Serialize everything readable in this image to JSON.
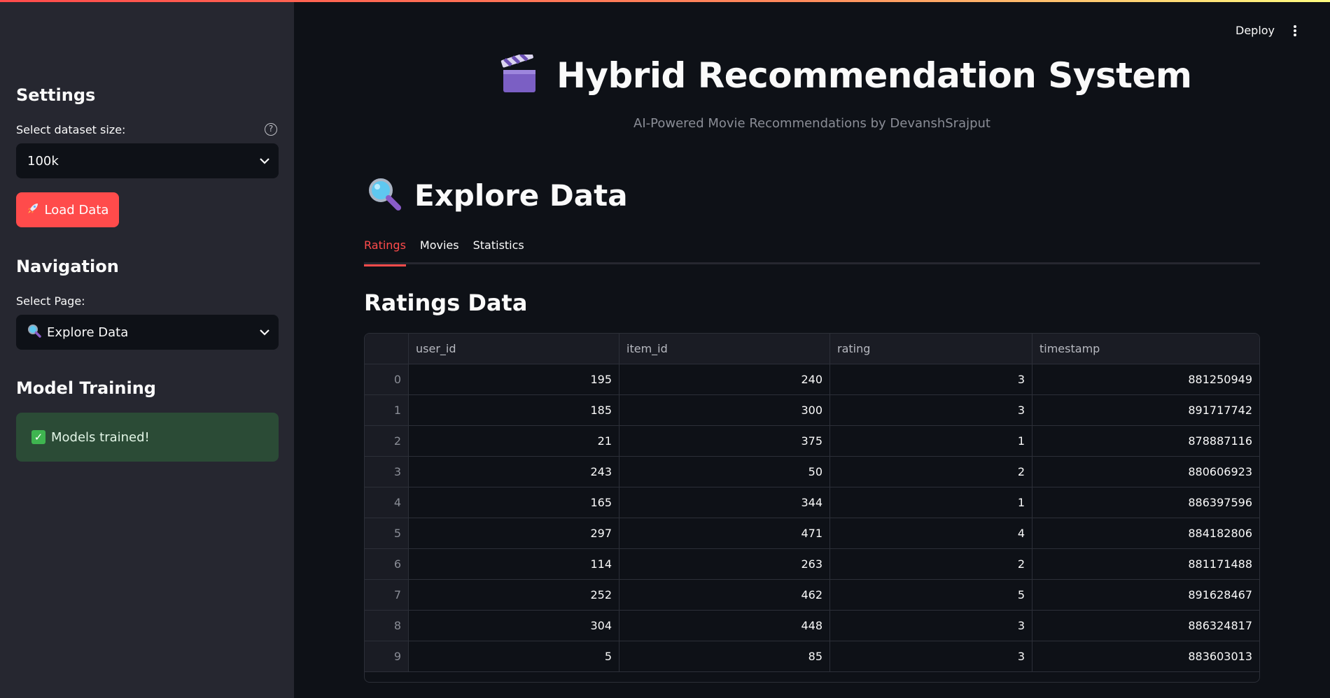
{
  "sidebar": {
    "settings_heading": "Settings",
    "dataset_label": "Select dataset size:",
    "dataset_value": "100k",
    "load_button": "Load Data",
    "navigation_heading": "Navigation",
    "page_label": "Select Page:",
    "page_value": "Explore Data",
    "model_heading": "Model Training",
    "success_message": "Models trained!"
  },
  "header": {
    "deploy_label": "Deploy"
  },
  "main": {
    "title": "Hybrid Recommendation System",
    "subtitle": "AI-Powered Movie Recommendations by DevanshSrajput",
    "section_title": "Explore Data",
    "tabs": [
      "Ratings",
      "Movies",
      "Statistics"
    ],
    "active_tab": "Ratings",
    "table_title": "Ratings Data",
    "table": {
      "columns": [
        "user_id",
        "item_id",
        "rating",
        "timestamp"
      ],
      "rows": [
        [
          "0",
          "195",
          "240",
          "3",
          "881250949"
        ],
        [
          "1",
          "185",
          "300",
          "3",
          "891717742"
        ],
        [
          "2",
          "21",
          "375",
          "1",
          "878887116"
        ],
        [
          "3",
          "243",
          "50",
          "2",
          "880606923"
        ],
        [
          "4",
          "165",
          "344",
          "1",
          "886397596"
        ],
        [
          "5",
          "297",
          "471",
          "4",
          "884182806"
        ],
        [
          "6",
          "114",
          "263",
          "2",
          "881171488"
        ],
        [
          "7",
          "252",
          "462",
          "5",
          "891628467"
        ],
        [
          "8",
          "304",
          "448",
          "3",
          "886324817"
        ],
        [
          "9",
          "5",
          "85",
          "3",
          "883603013"
        ]
      ]
    }
  },
  "colors": {
    "accent": "#ff4b4b",
    "sidebar_bg": "#262730",
    "main_bg": "#0e1117",
    "success_bg": "#2b4b36"
  },
  "icons": {
    "title": "clapper-board-icon",
    "section": "magnifier-icon",
    "load_button": "rocket-icon",
    "success": "check-box-icon",
    "help": "question-circle-icon",
    "menu": "kebab-menu-icon"
  }
}
